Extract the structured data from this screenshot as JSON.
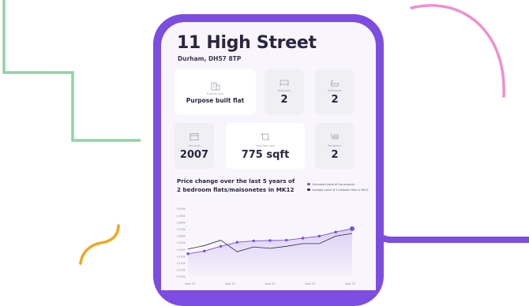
{
  "property": {
    "title": "11 High Street",
    "address": "Durham, DH57 8TP"
  },
  "cards": {
    "property_type": {
      "label": "Property type",
      "value": "Purpose built flat",
      "icon": "building-icon"
    },
    "bedrooms": {
      "label": "Bedrooms",
      "value": "2",
      "icon": "bed-icon"
    },
    "bathrooms": {
      "label": "Bathrooms",
      "value": "2",
      "icon": "bath-icon"
    },
    "year_built": {
      "label": "Year built",
      "value": "2007",
      "icon": "calendar-icon"
    },
    "floor_area": {
      "label": "Total floor area",
      "value": "775 sqft",
      "icon": "floor-area-icon"
    },
    "receptions": {
      "label": "Receptions",
      "value": "2",
      "icon": "sofa-icon"
    }
  },
  "chart_title": "Price change over the last 5 years of 2 bedroom flats/maisonetes in MK12",
  "colors": {
    "accent": "#7c4de0",
    "green": "#8fd3a4",
    "pink": "#ef8fcf",
    "orange": "#f0a81e",
    "dark": "#2b2540"
  },
  "chart_data": {
    "type": "line",
    "legend_position": "top-right",
    "grid": false,
    "y_ticks": [
      "£200k",
      "£190k",
      "£180k",
      "£170k",
      "£160k",
      "£150k",
      "£140k",
      "£130k",
      "£120k",
      "£110k",
      "£100k"
    ],
    "ylim": [
      100,
      200
    ],
    "x_ticks": [
      "Sept 19",
      "Sept 20",
      "Sept 21",
      "Sept 22",
      "Sept 23"
    ],
    "x": [
      0,
      0.5,
      1,
      1.5,
      2,
      2.5,
      3,
      3.5,
      4,
      4.5,
      5
    ],
    "series": [
      {
        "name": "Estimated value of the property",
        "color": "#7c4de0",
        "values": [
          134,
          138,
          145,
          151,
          153,
          153.5,
          154,
          157,
          160,
          166,
          171
        ],
        "markers": true
      },
      {
        "name": "Average value of 2 bedroom flats in MK12",
        "color": "#2b2540",
        "values": [
          141,
          146,
          154,
          137,
          144,
          142,
          145,
          149,
          149,
          160,
          164
        ]
      }
    ]
  }
}
